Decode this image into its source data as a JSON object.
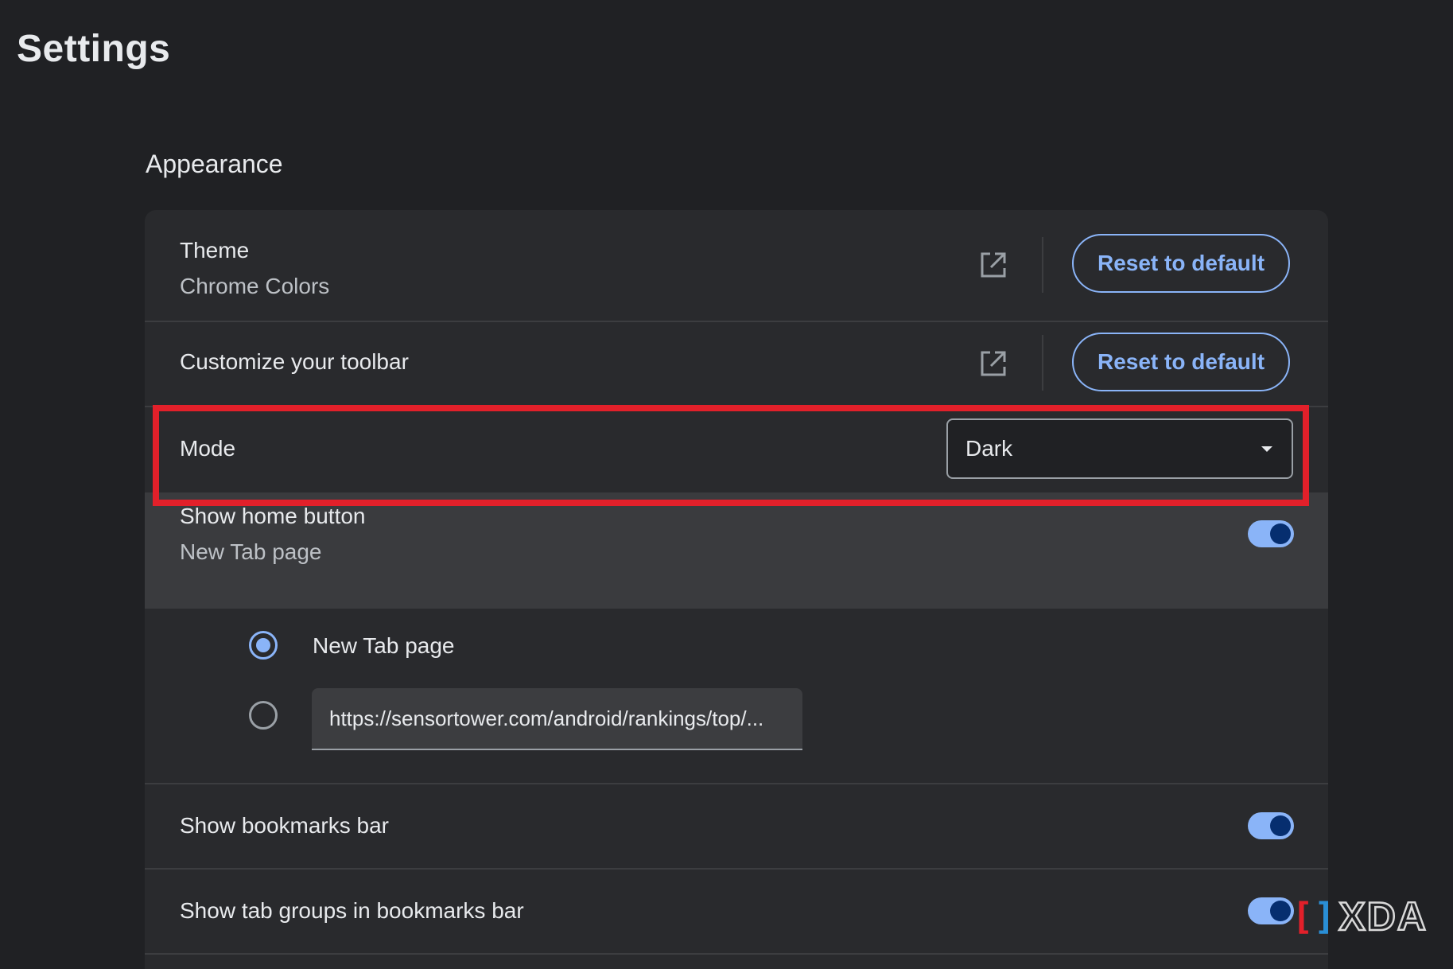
{
  "page": {
    "title": "Settings"
  },
  "section": {
    "title": "Appearance"
  },
  "theme_row": {
    "label": "Theme",
    "sublabel": "Chrome Colors",
    "icon": "open-in-new-icon",
    "reset_label": "Reset to default"
  },
  "toolbar_row": {
    "label": "Customize your toolbar",
    "icon": "open-in-new-icon",
    "reset_label": "Reset to default"
  },
  "mode_row": {
    "label": "Mode",
    "selected": "Dark",
    "highlight_color": "#e2202a"
  },
  "home_button_row": {
    "label": "Show home button",
    "sublabel": "New Tab page",
    "enabled": true,
    "options": [
      {
        "label": "New Tab page",
        "checked": true
      },
      {
        "label": "",
        "checked": false,
        "value": "https://sensortower.com/android/rankings/top/..."
      }
    ]
  },
  "bookmarks_bar_row": {
    "label": "Show bookmarks bar",
    "enabled": true
  },
  "tab_groups_row": {
    "label": "Show tab groups in bookmarks bar",
    "enabled": true
  },
  "watermark": {
    "text": "XDA"
  },
  "colors": {
    "background": "#202124",
    "card": "#292a2d",
    "accent": "#8ab4f8",
    "toggle_knob": "#062e6f"
  }
}
